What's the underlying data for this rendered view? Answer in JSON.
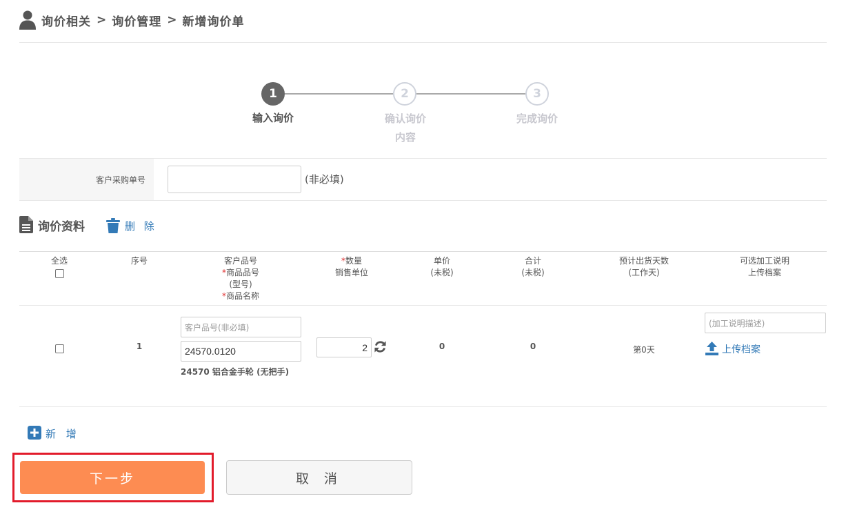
{
  "breadcrumb": {
    "items": [
      "询价相关",
      "询价管理",
      "新增询价单"
    ],
    "separator": ">"
  },
  "steps": [
    {
      "number": "1",
      "label_line1": "输入询价",
      "label_line2": "",
      "state": "active"
    },
    {
      "number": "2",
      "label_line1": "确认询价",
      "label_line2": "内容",
      "state": "todo"
    },
    {
      "number": "3",
      "label_line1": "完成询价",
      "label_line2": "",
      "state": "todo"
    }
  ],
  "po": {
    "label": "客户采购单号",
    "value": "",
    "hint": "(非必填)"
  },
  "section": {
    "title": "询价资料",
    "delete_label": "删 除"
  },
  "table": {
    "headers": {
      "select_all": "全选",
      "seq": "序号",
      "customer_part": "客户品号",
      "product_code": "商品品号",
      "model": "(型号)",
      "product_name": "商品名称",
      "quantity": "数量",
      "sales_unit": "销售单位",
      "unit_price": "单价",
      "unit_price_note": "(未税)",
      "total": "合计",
      "total_note": "(未税)",
      "lead_days": "预计出货天数",
      "lead_days_note": "(工作天)",
      "processing": "可选加工说明",
      "upload_header": "上传档案"
    },
    "required_mark": "*",
    "rows": [
      {
        "seq": "1",
        "customer_part_placeholder": "客户品号(非必填)",
        "product_code": "24570.0120",
        "product_name": "24570 铝合金手轮 (无把手)",
        "quantity": "2",
        "unit_price": "0",
        "total": "0",
        "lead_days": "第0天",
        "processing_placeholder": "(加工说明描述)",
        "upload_label": "上传档案"
      }
    ]
  },
  "add_label": "新 增",
  "buttons": {
    "next": "下一步",
    "cancel": "取 消"
  },
  "colors": {
    "primary_orange": "#fd8c52",
    "link_blue": "#337ab7",
    "highlight_red": "#e21b2b",
    "required_red": "#e03030"
  }
}
